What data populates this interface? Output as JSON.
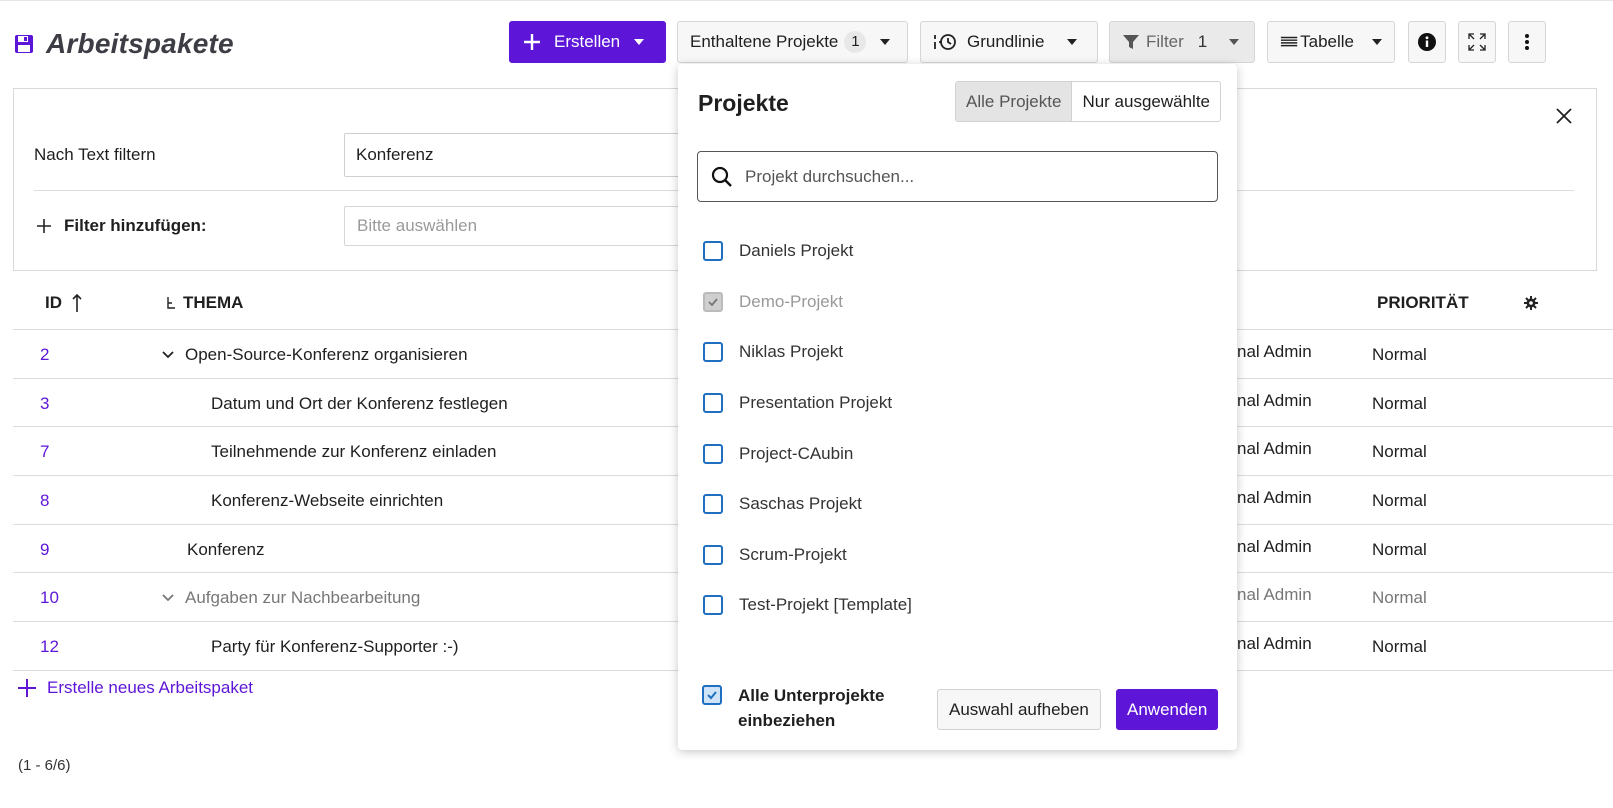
{
  "page": {
    "title": "Arbeitspakete"
  },
  "toolbar": {
    "create_label": "Erstellen",
    "included_projects_label": "Enthaltene Projekte",
    "included_projects_count": "1",
    "baseline_label": "Grundlinie",
    "filter_label": "Filter",
    "filter_count": "1",
    "view_label": "Tabelle"
  },
  "filters": {
    "text_filter_label": "Nach Text filtern",
    "text_filter_value": "Konferenz",
    "add_filter_label": "Filter hinzufügen:",
    "add_filter_placeholder": "Bitte auswählen"
  },
  "table": {
    "headers": {
      "id": "ID",
      "subject": "THEMA",
      "priority": "PRIORITÄT"
    },
    "rows": [
      {
        "id": "2",
        "subject": "Open-Source-Konferenz organisieren",
        "assignee": "nal Admin",
        "priority": "Normal"
      },
      {
        "id": "3",
        "subject": "Datum und Ort der Konferenz festlegen",
        "assignee": "nal Admin",
        "priority": "Normal"
      },
      {
        "id": "7",
        "subject": "Teilnehmende zur Konferenz einladen",
        "assignee": "nal Admin",
        "priority": "Normal"
      },
      {
        "id": "8",
        "subject": "Konferenz-Webseite einrichten",
        "assignee": "nal Admin",
        "priority": "Normal"
      },
      {
        "id": "9",
        "subject": "Konferenz",
        "assignee": "nal Admin",
        "priority": "Normal"
      },
      {
        "id": "10",
        "subject": "Aufgaben zur Nachbearbeitung",
        "assignee": "nal Admin",
        "priority": "Normal"
      },
      {
        "id": "12",
        "subject": "Party für Konferenz-Supporter :-)",
        "assignee": "nal Admin",
        "priority": "Normal"
      }
    ],
    "create_link": "Erstelle neues Arbeitspaket",
    "pagination": "(1 - 6/6)"
  },
  "project_dropdown": {
    "title": "Projekte",
    "tab_all": "Alle Projekte",
    "tab_selected": "Nur ausgewählte",
    "search_placeholder": "Projekt durchsuchen...",
    "projects": [
      {
        "name": "Daniels Projekt",
        "checked": false,
        "disabled": false
      },
      {
        "name": "Demo-Projekt",
        "checked": true,
        "disabled": true
      },
      {
        "name": "Niklas Projekt",
        "checked": false,
        "disabled": false
      },
      {
        "name": "Presentation Projekt",
        "checked": false,
        "disabled": false
      },
      {
        "name": "Project-CAubin",
        "checked": false,
        "disabled": false
      },
      {
        "name": "Saschas Projekt",
        "checked": false,
        "disabled": false
      },
      {
        "name": "Scrum-Projekt",
        "checked": false,
        "disabled": false
      },
      {
        "name": "Test-Projekt [Template]",
        "checked": false,
        "disabled": false
      }
    ],
    "include_subprojects_label": "Alle Unterprojekte einbeziehen",
    "include_subprojects_checked": true,
    "clear_label": "Auswahl aufheben",
    "apply_label": "Anwenden"
  },
  "colors": {
    "accent": "#5d16d8",
    "checkbox_border": "#1e6fbf"
  }
}
